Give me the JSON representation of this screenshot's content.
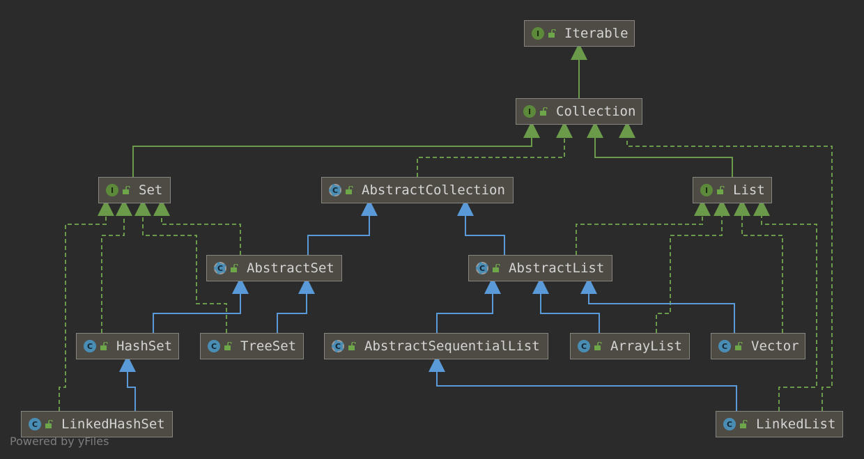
{
  "diagram": {
    "nodes": [
      {
        "id": "iterable",
        "label": "Iterable",
        "kind": "interface"
      },
      {
        "id": "collection",
        "label": "Collection",
        "kind": "interface"
      },
      {
        "id": "set",
        "label": "Set",
        "kind": "interface"
      },
      {
        "id": "abstract-collection",
        "label": "AbstractCollection",
        "kind": "abstract-class"
      },
      {
        "id": "list",
        "label": "List",
        "kind": "interface"
      },
      {
        "id": "abstract-set",
        "label": "AbstractSet",
        "kind": "abstract-class"
      },
      {
        "id": "abstract-list",
        "label": "AbstractList",
        "kind": "abstract-class"
      },
      {
        "id": "hash-set",
        "label": "HashSet",
        "kind": "class"
      },
      {
        "id": "tree-set",
        "label": "TreeSet",
        "kind": "class"
      },
      {
        "id": "abstract-sequential-list",
        "label": "AbstractSequentialList",
        "kind": "abstract-class"
      },
      {
        "id": "array-list",
        "label": "ArrayList",
        "kind": "class"
      },
      {
        "id": "vector",
        "label": "Vector",
        "kind": "class"
      },
      {
        "id": "linked-hash-set",
        "label": "LinkedHashSet",
        "kind": "class"
      },
      {
        "id": "linked-list",
        "label": "LinkedList",
        "kind": "class"
      }
    ],
    "edges": [
      {
        "from": "collection",
        "to": "iterable",
        "type": "extends-interface"
      },
      {
        "from": "set",
        "to": "collection",
        "type": "extends-interface"
      },
      {
        "from": "abstract-collection",
        "to": "collection",
        "type": "implements"
      },
      {
        "from": "list",
        "to": "collection",
        "type": "extends-interface"
      },
      {
        "from": "linked-list",
        "to": "collection",
        "type": "implements"
      },
      {
        "from": "abstract-set",
        "to": "abstract-collection",
        "type": "extends"
      },
      {
        "from": "abstract-list",
        "to": "abstract-collection",
        "type": "extends"
      },
      {
        "from": "abstract-set",
        "to": "set",
        "type": "implements"
      },
      {
        "from": "hash-set",
        "to": "set",
        "type": "implements"
      },
      {
        "from": "tree-set",
        "to": "set",
        "type": "implements"
      },
      {
        "from": "linked-hash-set",
        "to": "set",
        "type": "implements"
      },
      {
        "from": "hash-set",
        "to": "abstract-set",
        "type": "extends"
      },
      {
        "from": "tree-set",
        "to": "abstract-set",
        "type": "extends"
      },
      {
        "from": "linked-hash-set",
        "to": "hash-set",
        "type": "extends"
      },
      {
        "from": "abstract-sequential-list",
        "to": "abstract-list",
        "type": "extends"
      },
      {
        "from": "array-list",
        "to": "abstract-list",
        "type": "extends"
      },
      {
        "from": "vector",
        "to": "abstract-list",
        "type": "extends"
      },
      {
        "from": "linked-list",
        "to": "abstract-sequential-list",
        "type": "extends"
      },
      {
        "from": "abstract-list",
        "to": "list",
        "type": "implements"
      },
      {
        "from": "array-list",
        "to": "list",
        "type": "implements"
      },
      {
        "from": "vector",
        "to": "list",
        "type": "implements"
      },
      {
        "from": "linked-list",
        "to": "list",
        "type": "implements"
      }
    ]
  },
  "badges": {
    "interface": "I",
    "class": "C",
    "abstract_class": "C"
  },
  "legend_colors": {
    "extends_interface": "#6a9a4a",
    "implements": "#6a9a4a",
    "extends": "#5a9ad8",
    "background": "#2b2b2b",
    "node_fill": "#4e4b44"
  },
  "watermark": "Powered by yFiles"
}
